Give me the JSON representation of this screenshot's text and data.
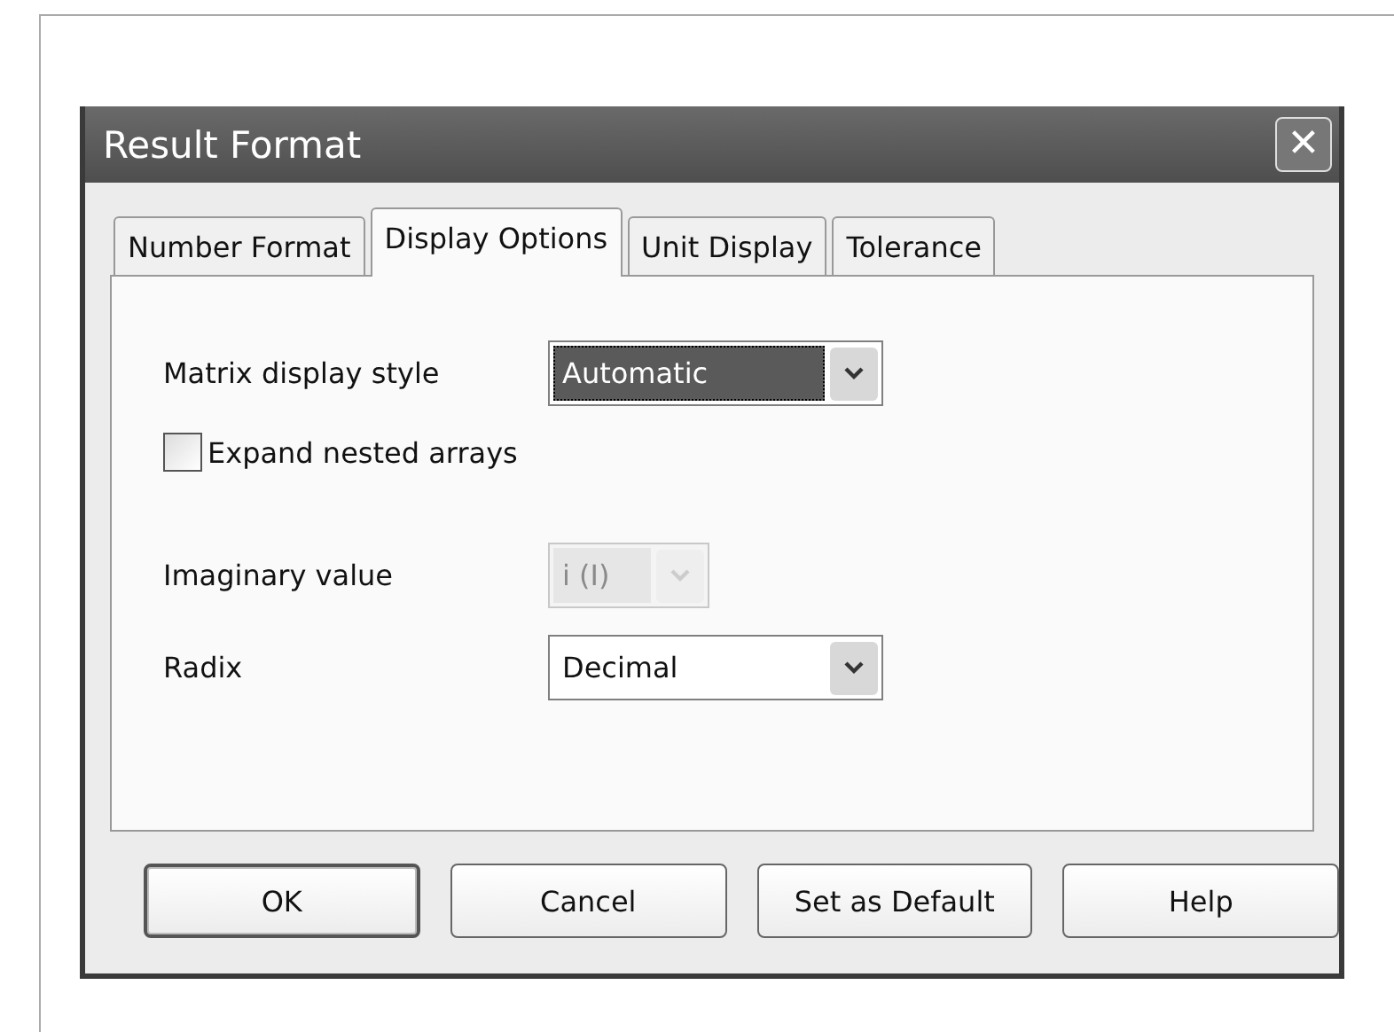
{
  "window": {
    "title": "Result Format",
    "close": "✕"
  },
  "tabs": [
    {
      "label": "Number Format",
      "selected": false
    },
    {
      "label": "Display Options",
      "selected": true
    },
    {
      "label": "Unit Display",
      "selected": false
    },
    {
      "label": "Tolerance",
      "selected": false
    }
  ],
  "fields": [
    {
      "kind": "combo",
      "label": "Matrix display style",
      "value": "Automatic",
      "focused": true,
      "disabled": false,
      "wide": true
    },
    {
      "kind": "checkbox",
      "label": "Expand nested arrays",
      "checked": false
    },
    {
      "kind": "combo",
      "label": "Imaginary value",
      "value": "i (I)",
      "focused": false,
      "disabled": true,
      "wide": false
    },
    {
      "kind": "combo",
      "label": "Radix",
      "value": "Decimal",
      "focused": false,
      "disabled": false,
      "wide": true
    }
  ],
  "buttons": [
    {
      "label": "OK",
      "default": true
    },
    {
      "label": "Cancel",
      "default": false
    },
    {
      "label": "Set as Default",
      "default": false
    },
    {
      "label": "Help",
      "default": false
    }
  ]
}
